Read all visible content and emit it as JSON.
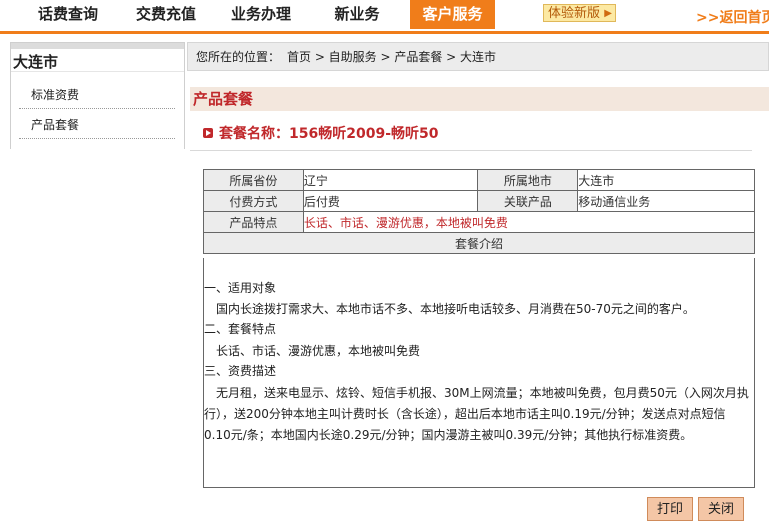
{
  "nav": {
    "items": [
      "话费查询",
      "交费充值",
      "业务办理",
      "新业务",
      "客户服务"
    ],
    "active": "客户服务",
    "trial": "体验新版",
    "trial_arrow": "▶",
    "back_home": ">>返回首页"
  },
  "sidebar": {
    "city": "大连市",
    "items": [
      "标准资费",
      "产品套餐"
    ]
  },
  "breadcrumb": {
    "label": "您所在的位置：",
    "path": "首页 > 自助服务 > 产品套餐 > 大连市"
  },
  "section_title": "产品套餐",
  "package_title": "套餐名称：156畅听2009-畅听50",
  "info": {
    "province_label": "所属省份",
    "province": "辽宁",
    "city_label": "所属地市",
    "city": "大连市",
    "payment_label": "付费方式",
    "payment": "后付费",
    "related_label": "关联产品",
    "related": "移动通信业务",
    "feature_label": "产品特点",
    "feature": "长话、市话、漫游优惠，本地被叫免费",
    "intro_label": "套餐介绍"
  },
  "description": {
    "lines": [
      "一、适用对象",
      "  国内长途拨打需求大、本地市话不多、本地接听电话较多、月消费在50-70元之间的客户。",
      "二、套餐特点",
      "  长话、市话、漫游优惠，本地被叫免费",
      "三、资费描述",
      "  无月租，送来电显示、炫铃、短信手机报、30M上网流量；本地被叫免费，包月费50元（入网次月执",
      "行），送200分钟本地主叫计费时长（含长途），超出后本地市话主叫0.19元/分钟；发送点对点短信",
      "0.10元/条；本地国内长途0.29元/分钟；国内漫游主被叫0.39元/分钟；其他执行标准资费。"
    ]
  },
  "buttons": {
    "print": "打印",
    "close": "关闭"
  }
}
